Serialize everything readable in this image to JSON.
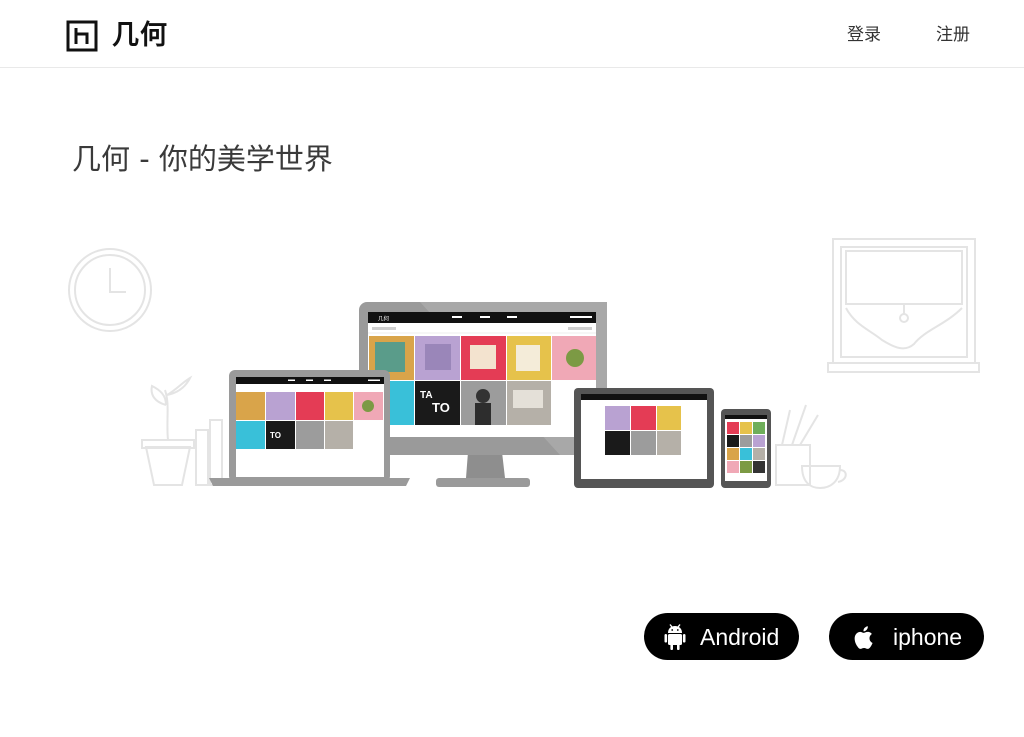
{
  "header": {
    "logo_text": "几何",
    "login_label": "登录",
    "register_label": "注册"
  },
  "hero": {
    "headline": "几何 - 你的美学世界"
  },
  "mockup_screen": {
    "brand": "几何"
  },
  "downloads": {
    "android_label": "Android",
    "iphone_label": "iphone"
  },
  "colors": {
    "button_bg": "#000000",
    "header_border": "#e9e9e9",
    "device_frame": "#9a9a9a",
    "tablet_frame": "#555555",
    "sketch_line": "#e2e2e2"
  },
  "icons": [
    "logo-mark-icon",
    "android-icon",
    "apple-icon",
    "clock-icon",
    "window-icon",
    "plant-icon",
    "cup-icon"
  ]
}
